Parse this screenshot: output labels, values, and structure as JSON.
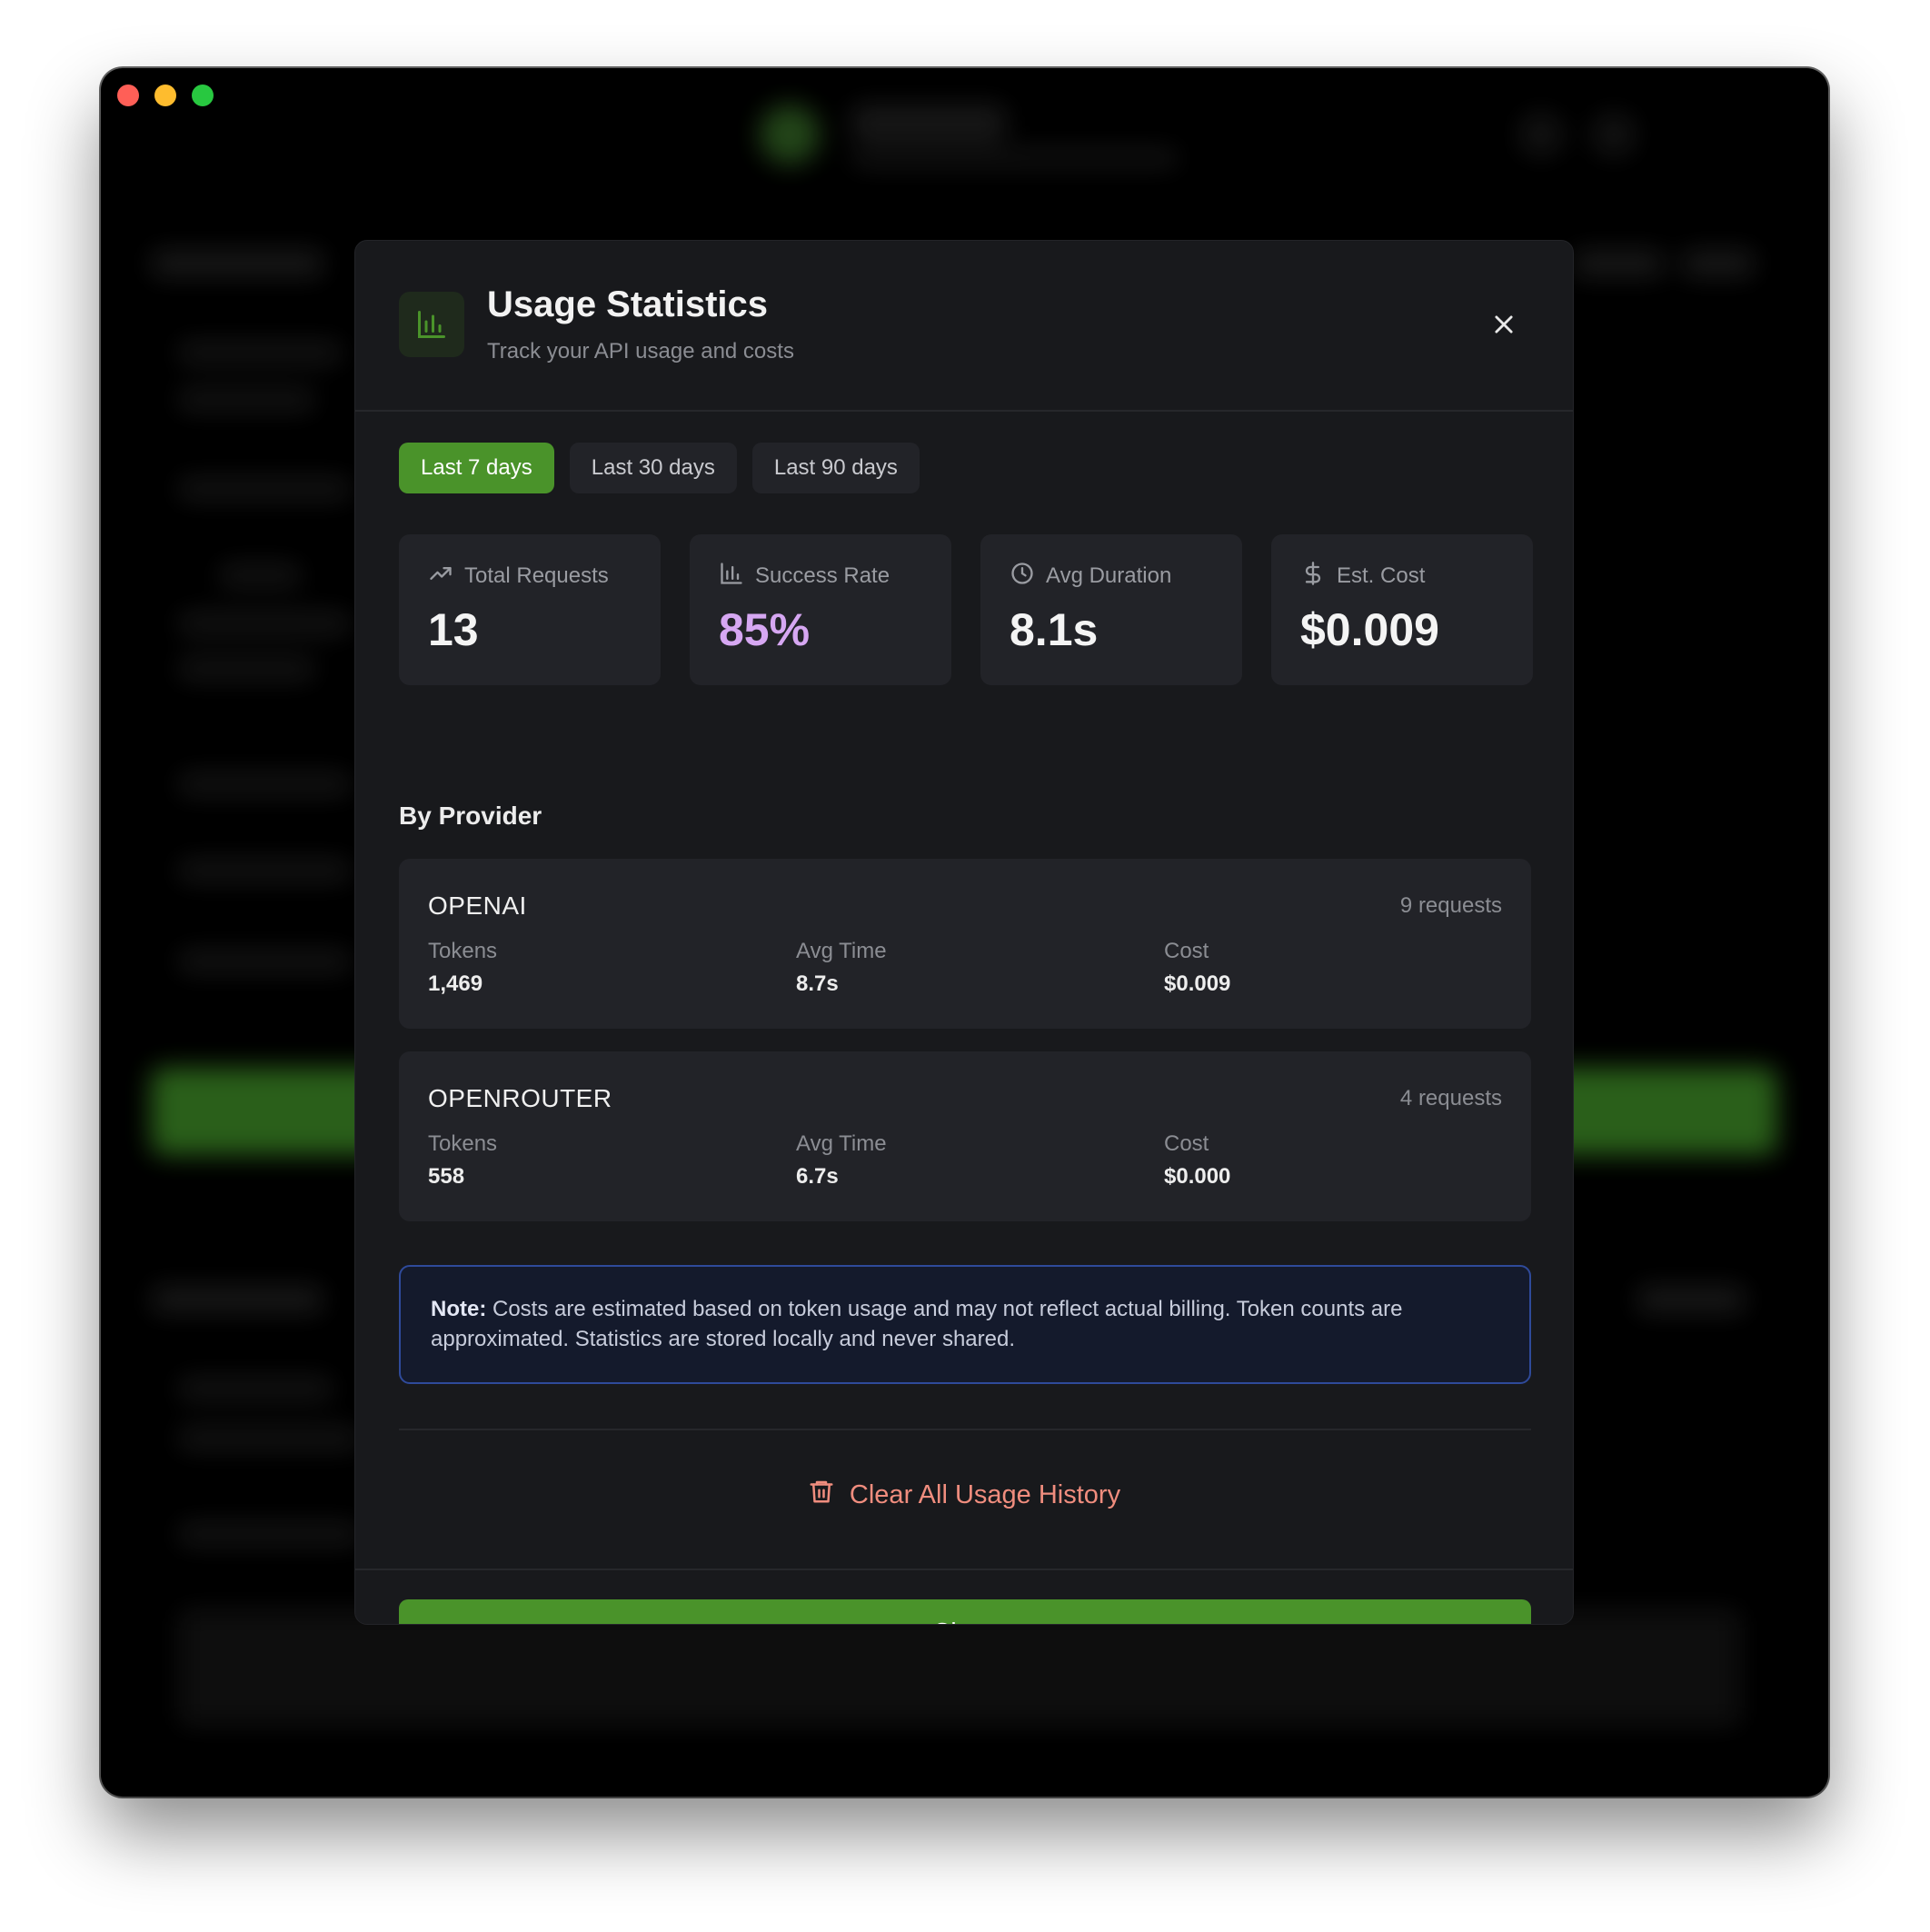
{
  "modal": {
    "title": "Usage Statistics",
    "subtitle": "Track your API usage and costs"
  },
  "tabs": [
    {
      "label": "Last 7 days",
      "active": true
    },
    {
      "label": "Last 30 days",
      "active": false
    },
    {
      "label": "Last 90 days",
      "active": false
    }
  ],
  "stats": [
    {
      "icon": "trending-up-icon",
      "label": "Total Requests",
      "value": "13"
    },
    {
      "icon": "bar-chart-icon",
      "label": "Success Rate",
      "value": "85%"
    },
    {
      "icon": "clock-icon",
      "label": "Avg Duration",
      "value": "8.1s"
    },
    {
      "icon": "dollar-icon",
      "label": "Est. Cost",
      "value": "$0.009"
    }
  ],
  "by_provider": {
    "title": "By Provider",
    "column_labels": {
      "tokens": "Tokens",
      "avg_time": "Avg Time",
      "cost": "Cost"
    },
    "providers": [
      {
        "name": "OPENAI",
        "requests": "9 requests",
        "tokens": "1,469",
        "avg_time": "8.7s",
        "cost": "$0.009"
      },
      {
        "name": "OPENROUTER",
        "requests": "4 requests",
        "tokens": "558",
        "avg_time": "6.7s",
        "cost": "$0.000"
      }
    ]
  },
  "note": {
    "prefix": "Note:",
    "text": " Costs are estimated based on token usage and may not reflect actual billing. Token counts are approximated. Statistics are stored locally and never shared."
  },
  "clear_label": "Clear All Usage History",
  "close_label": "Close",
  "colors": {
    "accent": "#4a932a",
    "success_rate": "#d6a7f2",
    "danger": "#f08d7e",
    "note_border": "#2f4a9a"
  }
}
